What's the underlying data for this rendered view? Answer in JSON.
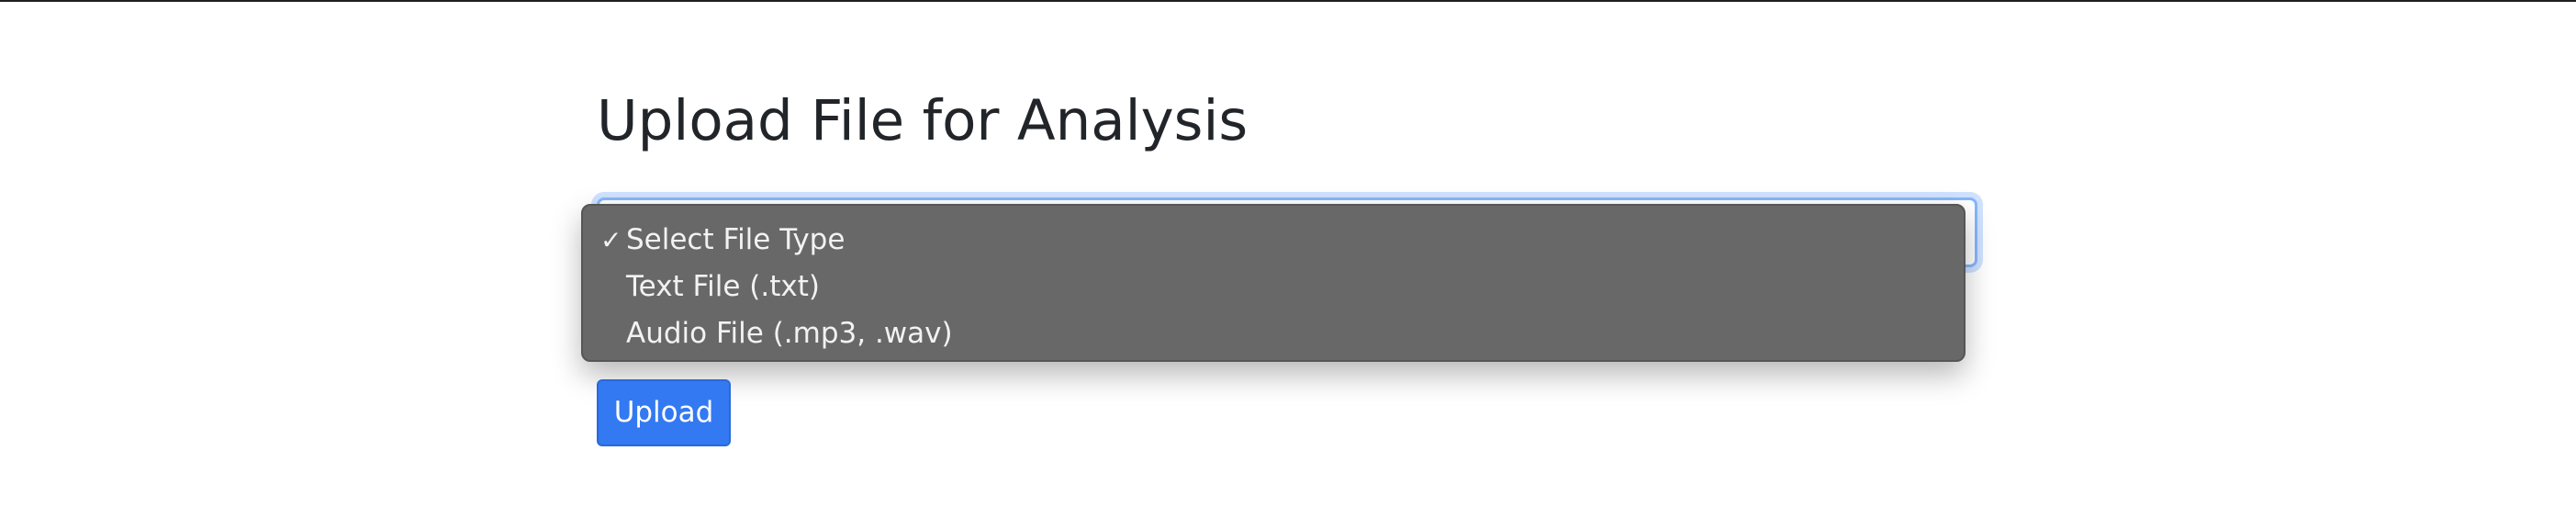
{
  "page": {
    "title": "Upload File for Analysis"
  },
  "file_type_select": {
    "selected": "Select File Type",
    "options": [
      "Select File Type",
      "Text File (.txt)",
      "Audio File (.mp3, .wav)"
    ],
    "selected_index": 0,
    "focus_color": "#86b7fe",
    "menu_color": "#676867"
  },
  "actions": {
    "upload_label": "Upload",
    "upload_color": "#3379f2"
  },
  "icons": {
    "checkmark": "check-icon",
    "chevron": "chevron-down-icon"
  }
}
